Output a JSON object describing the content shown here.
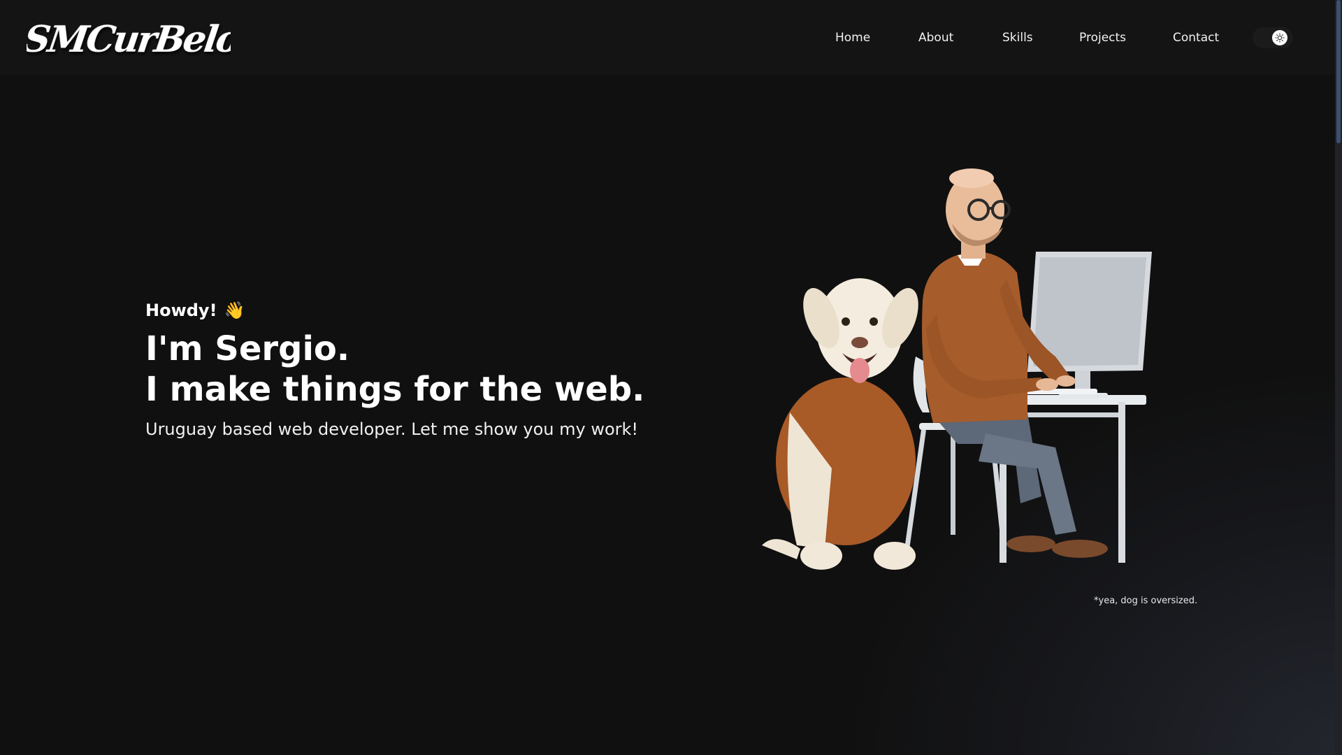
{
  "header": {
    "logo_text": "SMCurBelo/>",
    "nav": {
      "home": "Home",
      "about": "About",
      "skills": "Skills",
      "projects": "Projects",
      "contact": "Contact"
    },
    "theme_toggle_icon": "sun-icon"
  },
  "hero": {
    "greeting": "Howdy!",
    "greeting_emoji": "👋",
    "headline_line1": "I'm Sergio.",
    "headline_line2": "I make things for the web.",
    "subline": "Uruguay based web developer. Let me show you my work!",
    "image_caption": "*yea, dog is oversized."
  },
  "colors": {
    "background": "#101010",
    "header_background": "#141414",
    "text": "#ffffff",
    "scroll_thumb": "#3c5070"
  }
}
